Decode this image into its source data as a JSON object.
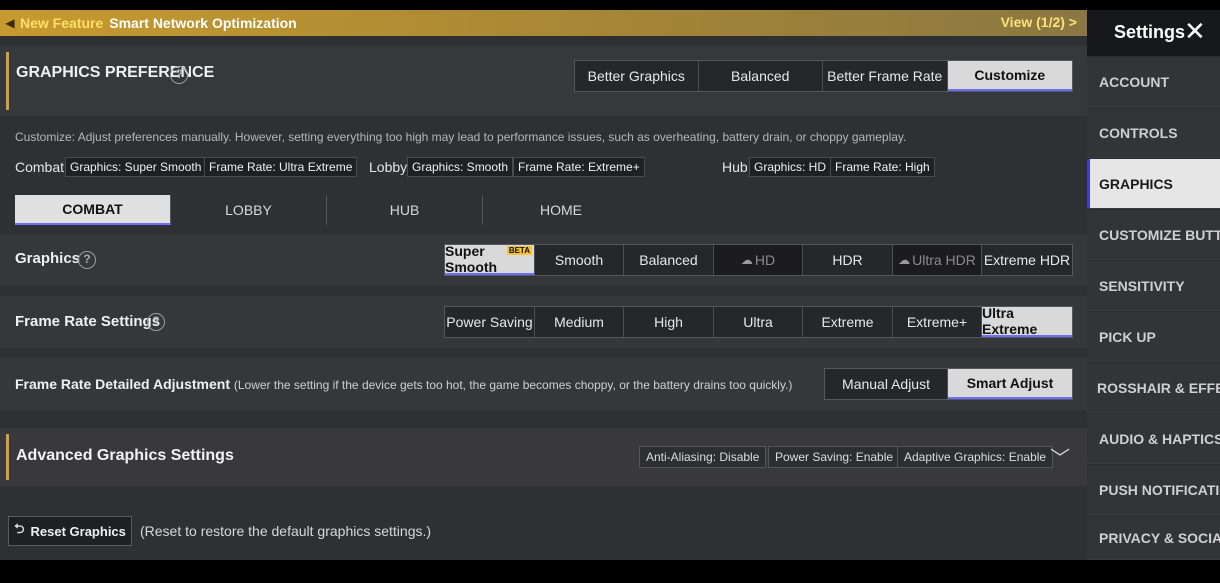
{
  "banner": {
    "speaker_icon": "◀",
    "new_feature": "New Feature",
    "title": "Smart Network Optimization",
    "view": "View (1/2) >"
  },
  "preference": {
    "title": "GRAPHICS PREFERENCE",
    "help": "?",
    "options": [
      "Better Graphics",
      "Balanced",
      "Better Frame Rate",
      "Customize"
    ],
    "selected": "Customize",
    "description": "Customize: Adjust preferences manually. However, setting everything too high may lead to performance issues, such as overheating, battery drain, or choppy gameplay."
  },
  "summary": {
    "combat_label": "Combat",
    "combat_graphics": "Graphics: Super Smooth",
    "combat_fps": "Frame Rate: Ultra Extreme",
    "lobby_label": "Lobby",
    "lobby_graphics": "Graphics: Smooth",
    "lobby_fps": "Frame Rate: Extreme+",
    "hub_label": "Hub",
    "hub_graphics": "Graphics: HD",
    "hub_fps": "Frame Rate: High"
  },
  "mode_tabs": [
    "COMBAT",
    "LOBBY",
    "HUB",
    "HOME"
  ],
  "graphics": {
    "label": "Graphics",
    "help": "?",
    "options": [
      "Super Smooth",
      "Smooth",
      "Balanced",
      "HD",
      "HDR",
      "Ultra HDR",
      "Extreme HDR"
    ],
    "beta_badge": "BETA",
    "selected": "Super Smooth"
  },
  "frame_rate": {
    "label": "Frame Rate Settings",
    "help": "?",
    "options": [
      "Power Saving",
      "Medium",
      "High",
      "Ultra",
      "Extreme",
      "Extreme+",
      "Ultra Extreme"
    ],
    "selected": "Ultra Extreme"
  },
  "frame_adjust": {
    "label": "Frame Rate Detailed Adjustment",
    "note": "(Lower the setting if the device gets too hot, the game becomes choppy, or the battery drains too quickly.)",
    "options": [
      "Manual Adjust",
      "Smart Adjust"
    ],
    "selected": "Smart Adjust"
  },
  "advanced": {
    "title": "Advanced Graphics Settings",
    "tags": [
      "Anti-Aliasing: Disable",
      "Power Saving: Enable",
      "Adaptive Graphics: Enable"
    ],
    "chevron": "﹀"
  },
  "reset": {
    "button": "Reset Graphics",
    "icon": "⮌",
    "note": "(Reset to restore the default graphics settings.)"
  },
  "sidebar": {
    "title": "Settings",
    "close": "✕",
    "items": [
      "ACCOUNT",
      "CONTROLS",
      "GRAPHICS",
      "CUSTOMIZE BUTTON",
      "SENSITIVITY",
      "PICK UP",
      "ROSSHAIR & EFFECT",
      "AUDIO & HAPTICS",
      "PUSH NOTIFICATION",
      "PRIVACY & SOCIAL"
    ],
    "selected": "GRAPHICS"
  },
  "colors": {
    "accent_gold": "#d1a23a",
    "selected_bg": "#d9d9d9",
    "selected_underline": "#6a6fff",
    "beta": "#f6c23a"
  },
  "icons": {
    "help": "question-circle-icon",
    "cloud": "cloud-download-icon",
    "chevron": "chevron-down-icon",
    "reset": "reset-icon",
    "close": "close-icon",
    "speaker": "speaker-icon"
  }
}
